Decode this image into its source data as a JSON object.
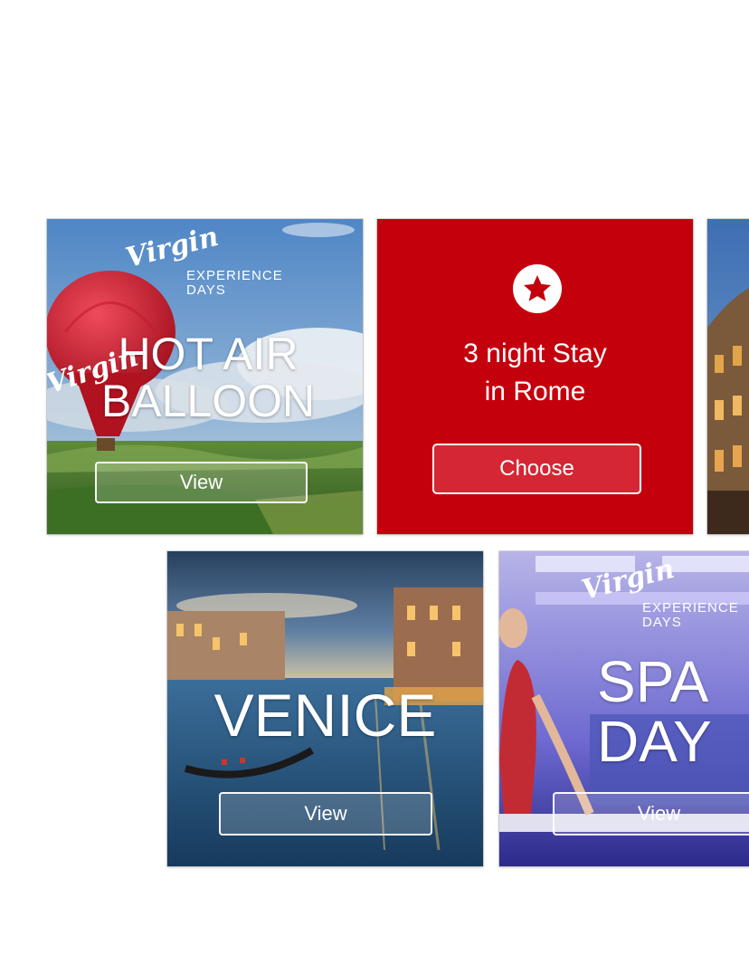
{
  "brand": {
    "logo_script": "Virgin",
    "logo_line1": "EXPERIENCE",
    "logo_line2": "DAYS",
    "accent_red": "#c4000d"
  },
  "tiles": {
    "balloon": {
      "title_line1": "HOT AIR",
      "title_line2": "BALLOON",
      "balloon_text": "Virgin",
      "button_label": "View"
    },
    "rome": {
      "icon": "star-icon",
      "line1": "3 night Stay",
      "line2": "in Rome",
      "button_label": "Choose"
    },
    "venice": {
      "title": "VENICE",
      "button_label": "View"
    },
    "spa": {
      "title_line1": "SPA",
      "title_line2": "DAY",
      "button_label": "View"
    }
  }
}
